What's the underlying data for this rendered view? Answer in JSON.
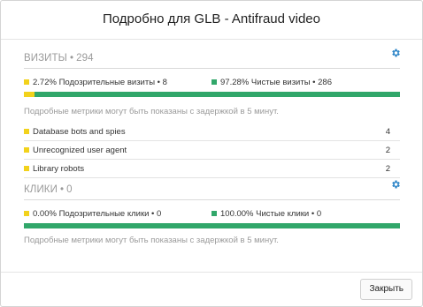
{
  "dialog": {
    "title": "Подробно для GLB - Antifraud video",
    "close_label": "Закрыть"
  },
  "colors": {
    "suspicious": "#f2d21c",
    "clean": "#31a76a",
    "gear": "#2f86c8"
  },
  "visits": {
    "title": "ВИЗИТЫ",
    "separator": "•",
    "total": "294",
    "suspicious_label": "2.72% Подозрительные визиты • 8",
    "clean_label": "97.28% Чистые визиты • 286",
    "suspicious_fraction": 0.0272,
    "note": "Подробные метрики могут быть показаны с задержкой в 5 минут.",
    "reasons": [
      {
        "label": "Database bots and spies",
        "count": "4"
      },
      {
        "label": "Unrecognized user agent",
        "count": "2"
      },
      {
        "label": "Library robots",
        "count": "2"
      }
    ]
  },
  "clicks": {
    "title": "КЛИКИ",
    "separator": "•",
    "total": "0",
    "suspicious_label": "0.00% Подозрительные клики • 0",
    "clean_label": "100.00% Чистые клики • 0",
    "suspicious_fraction": 0.0,
    "note": "Подробные метрики могут быть показаны с задержкой в 5 минут."
  },
  "icons": {
    "settings": "gear-icon"
  }
}
